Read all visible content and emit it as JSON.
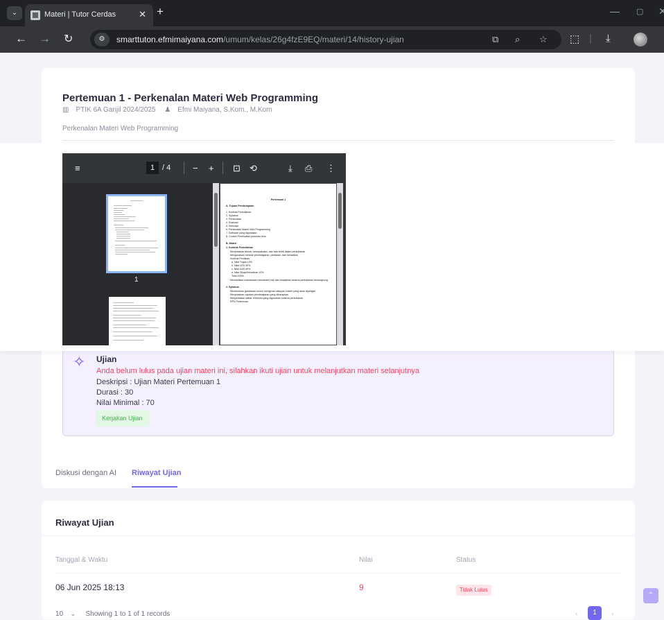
{
  "browser": {
    "tab_title": "Materi | Tutor Cerdas",
    "url_host": "smarttuton.efmimaiyana.com",
    "url_path": "/umum/kelas/26g4fzE9EQ/materi/14/history-ujian"
  },
  "materi": {
    "title": "Pertemuan 1 - Perkenalan Materi Web Programming",
    "class_name": "PTIK 6A Ganjil 2024/2025",
    "lecturer": "Efmi Maiyana, S.Kom., M.Kom",
    "description": "Perkenalan Materi Web Programming"
  },
  "pdf": {
    "current_page": "1",
    "total_pages": "/ 4",
    "thumb_label": "1",
    "doc": {
      "heading": "Pertemuan 1",
      "section_a": "A. Tujuan Pembelajaran",
      "items_a": [
        "1. Kontrak Perkuliahan",
        "2. Syllabus",
        "3. Perkenalan",
        "4. Evaluasi",
        "5. Semuapi",
        "6. Perkenalan Materi Web Programming",
        "7. Software yang digunakan",
        "8. Contoh Pembuatan prosedur teks"
      ],
      "section_b": "B. Materi",
      "sub_b1": "1. Kontrak Perkuliahan",
      "items_b1": [
        "Menjelaskan aturan, kesepakatan, dan tata tertib dalam perkuliahan",
        "Menguraikan metode pembelajaran, penilaian, dan kehadiran",
        "Kontrak Penilaian:",
        "a. Nilai Tugas          10%",
        "b. Nilai UTS             30%",
        "c. Nilai UAS             40%",
        "d. Nilai Sikap/Kehadiran    10%",
        "Total                       100%",
        "Memastikan mahasiswa memahami hak dan kewajiban selama perkuliahan berlangsung"
      ],
      "sub_b2": "2. Syllabus",
      "items_b2": [
        "Memberikan gambaran umum mengenai cakupan materi yang akan dipelajari",
        "Menjelaskan capaian pembelajaran yang diharapkan",
        "Menyediakan daftar referensi yang digunakan selama perkuliahan",
        "RPS Pertemuan"
      ]
    }
  },
  "exam": {
    "title": "Ujian",
    "warning": "Anda belum lulus pada ujian materi ini, silahkan ikuti ujian untuk melanjutkan materi selanjutnya",
    "description": "Deskripsi : Ujian Materi Pertemuan 1",
    "duration": "Durasi : 30",
    "min_score": "Nilai Minimal : 70",
    "start_button": "Kerjakan Ujian"
  },
  "tabs": [
    {
      "label": "Diskusi dengan AI",
      "active": false
    },
    {
      "label": "Riwayat Ujian",
      "active": true
    }
  ],
  "history": {
    "title": "Riwayat Ujian",
    "columns": [
      "Tanggal & Waktu",
      "Nilai",
      "Status"
    ],
    "rows": [
      {
        "datetime": "06 Jun 2025 18:13",
        "score": "9",
        "status": "Tidak Lulus"
      }
    ],
    "per_page": "10",
    "showing": "Showing 1 to 1 of 1 records",
    "current_page": "1"
  },
  "colors": {
    "primary": "#7367f0",
    "danger": "#ff3e5a",
    "success": "#4caf50",
    "exam_bg": "#f5f0ff"
  },
  "icons": {
    "exam": "pin-icon",
    "pdf_menu": "menu-icon",
    "pdf_download": "download-icon",
    "pdf_print": "print-icon"
  }
}
